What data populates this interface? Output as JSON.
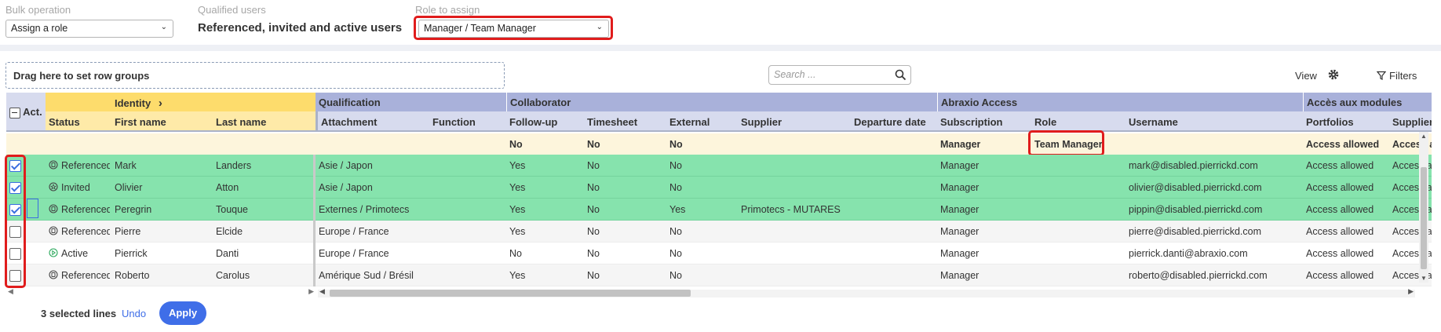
{
  "toolbar": {
    "bulk_label": "Bulk operation",
    "bulk_value": "Assign a role",
    "qualified_label": "Qualified users",
    "qualified_value": "Referenced, invited and active users",
    "role_label": "Role to assign",
    "role_value": "Manager / Team Manager"
  },
  "grid_toolbar": {
    "dropzone": "Drag here to set row groups",
    "search_placeholder": "Search ...",
    "view": "View",
    "filters": "Filters"
  },
  "groups": {
    "act": "Act.",
    "identity": "Identity",
    "identity_chevron": "›",
    "qualification": "Qualification",
    "collaborator": "Collaborator",
    "abraxio": "Abraxio Access",
    "modules": "Accès aux modules"
  },
  "columns": {
    "status": "Status",
    "first_name": "First name",
    "last_name": "Last name",
    "attachment": "Attachment",
    "function": "Function",
    "followup": "Follow-up",
    "timesheet": "Timesheet",
    "external": "External",
    "supplier": "Supplier",
    "departure": "Departure date",
    "subscription": "Subscription",
    "role": "Role",
    "username": "Username",
    "portfolios": "Portfolios",
    "suppliers": "Suppliers"
  },
  "bulk_row": {
    "followup": "No",
    "timesheet": "No",
    "external": "No",
    "subscription": "Manager",
    "role": "Team Manager",
    "portfolios": "Access allowed",
    "suppliers": "Access allowed"
  },
  "rows": [
    {
      "checked": true,
      "status": "Referenced",
      "status_icon": "referenced-icon",
      "first": "Mark",
      "last": "Landers",
      "attachment": "Asie / Japon",
      "followup": "Yes",
      "timesheet": "No",
      "external": "No",
      "supplier": "",
      "subscription": "Manager",
      "username": "mark@disabled.pierrickd.com",
      "portfolios": "Access allowed",
      "suppliers": "Access allowed"
    },
    {
      "checked": true,
      "status": "Invited",
      "status_icon": "invited-icon",
      "first": "Olivier",
      "last": "Atton",
      "attachment": "Asie / Japon",
      "followup": "Yes",
      "timesheet": "No",
      "external": "No",
      "supplier": "",
      "subscription": "Manager",
      "username": "olivier@disabled.pierrickd.com",
      "portfolios": "Access allowed",
      "suppliers": "Access allowed"
    },
    {
      "checked": true,
      "status": "Referenced",
      "status_icon": "referenced-icon",
      "first": "Peregrin",
      "last": "Touque",
      "attachment": "Externes / Primotecs",
      "followup": "Yes",
      "timesheet": "No",
      "external": "Yes",
      "supplier": "Primotecs - MUTARES",
      "subscription": "Manager",
      "username": "pippin@disabled.pierrickd.com",
      "portfolios": "Access allowed",
      "suppliers": "Access allowed"
    },
    {
      "checked": false,
      "status": "Referenced",
      "status_icon": "referenced-icon",
      "first": "Pierre",
      "last": "Elcide",
      "attachment": "Europe / France",
      "followup": "Yes",
      "timesheet": "No",
      "external": "No",
      "supplier": "",
      "subscription": "Manager",
      "username": "pierre@disabled.pierrickd.com",
      "portfolios": "Access allowed",
      "suppliers": "Access allowed"
    },
    {
      "checked": false,
      "status": "Active",
      "status_icon": "active-icon",
      "first": "Pierrick",
      "last": "Danti",
      "attachment": "Europe / France",
      "followup": "No",
      "timesheet": "No",
      "external": "No",
      "supplier": "",
      "subscription": "Manager",
      "username": "pierrick.danti@abraxio.com",
      "portfolios": "Access allowed",
      "suppliers": "Access allowed"
    },
    {
      "checked": false,
      "status": "Referenced",
      "status_icon": "referenced-icon",
      "first": "Roberto",
      "last": "Carolus",
      "attachment": "Amérique Sud / Brésil",
      "followup": "Yes",
      "timesheet": "No",
      "external": "No",
      "supplier": "",
      "subscription": "Manager",
      "username": "roberto@disabled.pierrickd.com",
      "portfolios": "Access allowed",
      "suppliers": "Access allowed"
    }
  ],
  "footer": {
    "selected": "3 selected lines",
    "undo": "Undo",
    "apply": "Apply"
  },
  "colors": {
    "selected_row": "#86e3ad",
    "identity_group": "#fddc6c",
    "identity_header": "#feeaa8",
    "other_group": "#a9b1da",
    "other_header": "#d7dbee",
    "bulk_row": "#fdf5dc",
    "highlight": "#e01c1c",
    "apply": "#3f6ee8"
  }
}
